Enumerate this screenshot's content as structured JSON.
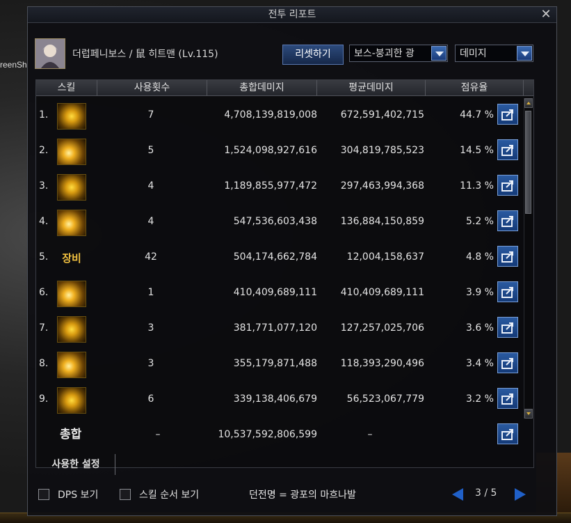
{
  "window": {
    "title": "전투 리포트",
    "close_glyph": "✕"
  },
  "background": {
    "left_text": "reenSh"
  },
  "header": {
    "character": "더럽페니보스 / 鼠 히트맨 (Lv.115)",
    "reset_label": "리셋하기",
    "boss_select": "보스-붕괴한 광",
    "metric_select": "데미지"
  },
  "table": {
    "columns": [
      "스킬",
      "사용횟수",
      "총합데미지",
      "평균데미지",
      "점유율"
    ],
    "rows": [
      {
        "rank": "1.",
        "icon": "slash-skill-icon",
        "icon_text": "",
        "uses": "7",
        "total": "4,708,139,819,008",
        "avg": "672,591,402,715",
        "share": "44.7 %"
      },
      {
        "rank": "2.",
        "icon": "claw-skill-icon",
        "icon_text": "",
        "uses": "5",
        "total": "1,524,098,927,616",
        "avg": "304,819,785,523",
        "share": "14.5 %"
      },
      {
        "rank": "3.",
        "icon": "crescent-skill-icon",
        "icon_text": "",
        "uses": "4",
        "total": "1,189,855,977,472",
        "avg": "297,463,994,368",
        "share": "11.3 %"
      },
      {
        "rank": "4.",
        "icon": "cross-slash-skill-icon",
        "icon_text": "",
        "uses": "4",
        "total": "547,536,603,438",
        "avg": "136,884,150,859",
        "share": "5.2 %"
      },
      {
        "rank": "5.",
        "icon": "equipment-text-icon",
        "icon_text": "장비",
        "uses": "42",
        "total": "504,174,662,784",
        "avg": "12,004,158,637",
        "share": "4.8 %"
      },
      {
        "rank": "6.",
        "icon": "burst-skill-icon",
        "icon_text": "",
        "uses": "1",
        "total": "410,409,689,111",
        "avg": "410,409,689,111",
        "share": "3.9 %"
      },
      {
        "rank": "7.",
        "icon": "dash-skill-icon",
        "icon_text": "",
        "uses": "3",
        "total": "381,771,077,120",
        "avg": "127,257,025,706",
        "share": "3.6 %"
      },
      {
        "rank": "8.",
        "icon": "blade-skill-icon",
        "icon_text": "",
        "uses": "3",
        "total": "355,179,871,488",
        "avg": "118,393,290,496",
        "share": "3.4 %"
      },
      {
        "rank": "9.",
        "icon": "spiral-skill-icon",
        "icon_text": "",
        "uses": "6",
        "total": "339,138,406,679",
        "avg": "56,523,067,779",
        "share": "3.2 %"
      }
    ],
    "total": {
      "label": "총합",
      "uses": "–",
      "total": "10,537,592,806,599",
      "avg": "–"
    }
  },
  "settings_tab": "사용한 설정",
  "footer": {
    "dps_label": "DPS 보기",
    "skill_order_label": "스킬 순서 보기",
    "dungeon": "던전명 = 광포의 마흐나발",
    "page": "3 / 5"
  },
  "colors": {
    "accent_blue": "#2060c8",
    "skill_gold": "#f0c040"
  }
}
